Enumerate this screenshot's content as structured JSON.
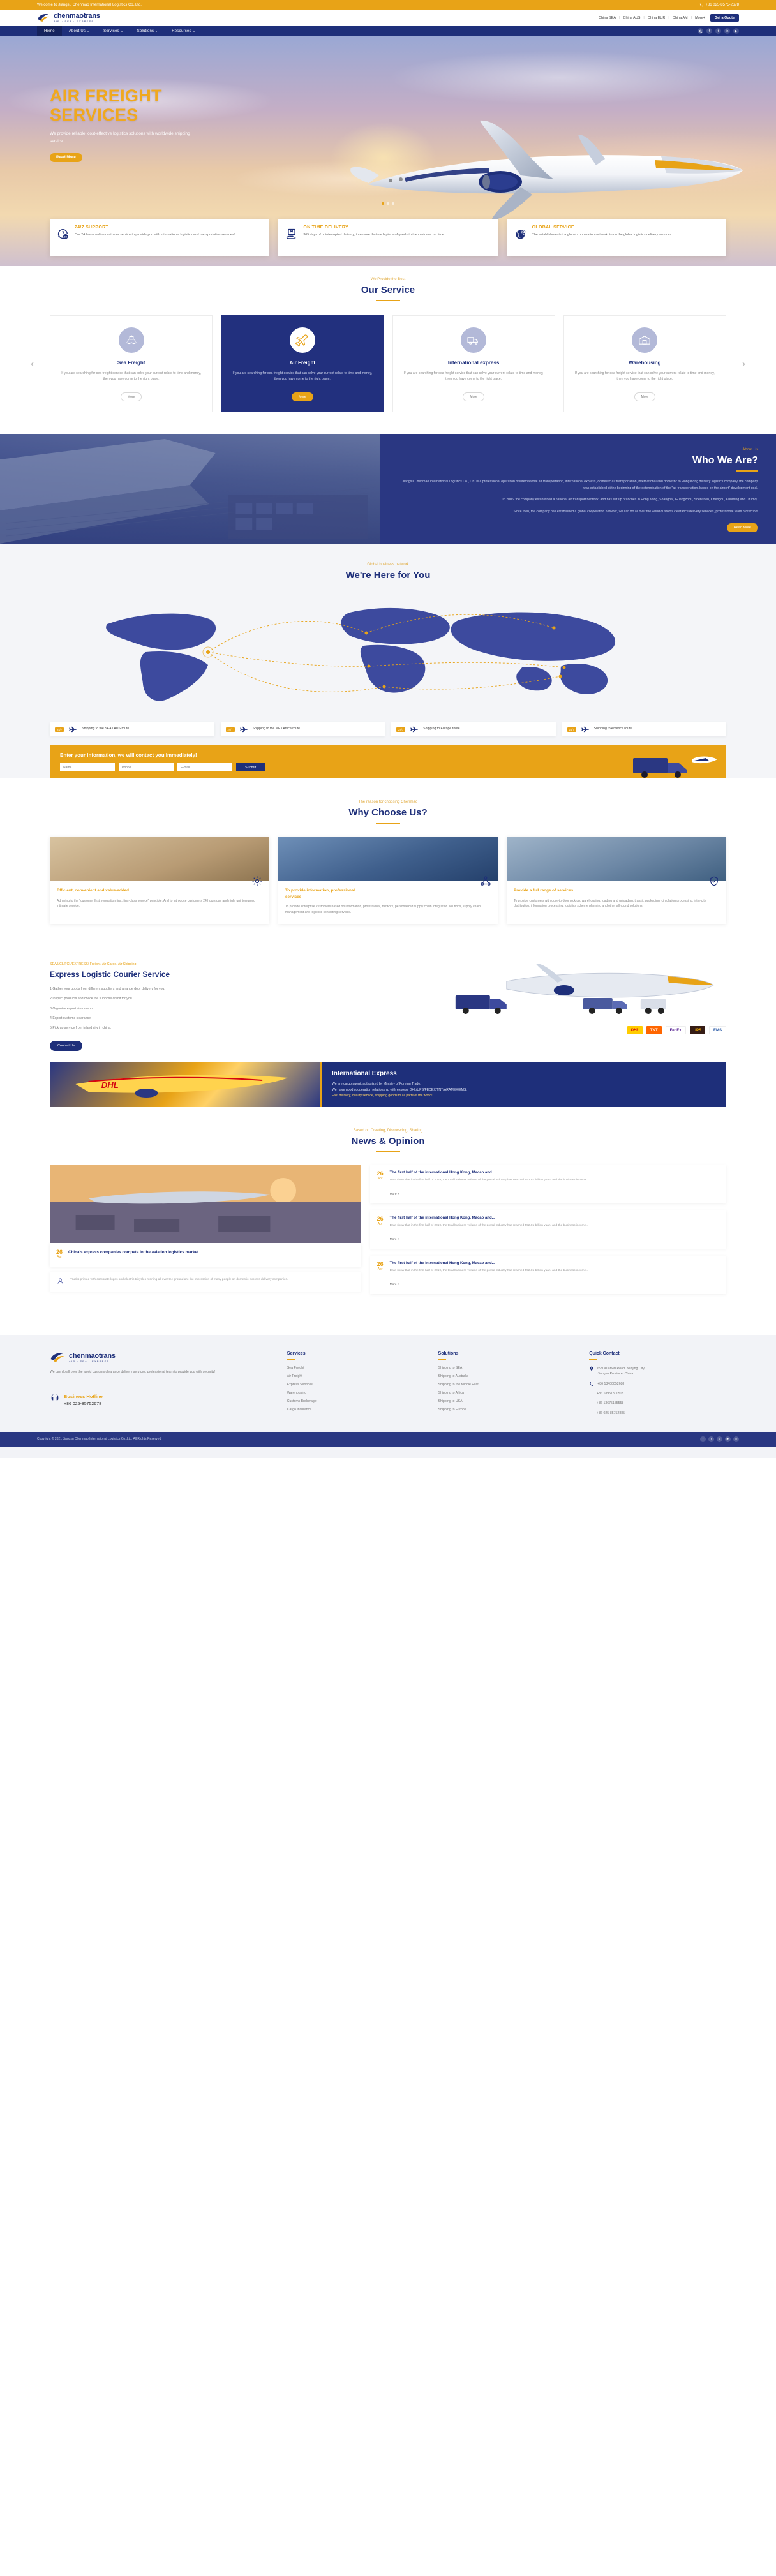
{
  "topbar": {
    "welcome": "Welcome to Jiangsu Chenmao International Logistics  Co.,Ltd.",
    "phone": "+86 025-8575-2678",
    "phone_icon": "phone-icon"
  },
  "header": {
    "logo_name": "chenmaotrans",
    "logo_sub": "AIR · SEA · EXPRESS",
    "lang": [
      "China SEA",
      "China AUS",
      "China EUR",
      "China AM",
      "More+"
    ],
    "quote_button": "Get a Quote"
  },
  "nav": {
    "items": [
      {
        "label": "Home",
        "caret": false,
        "active": true
      },
      {
        "label": "About Us",
        "caret": true,
        "active": false
      },
      {
        "label": "Services",
        "caret": true,
        "active": false
      },
      {
        "label": "Solutions",
        "caret": true,
        "active": false
      },
      {
        "label": "Resources",
        "caret": true,
        "active": false
      }
    ],
    "icons": [
      "search-icon",
      "facebook-icon",
      "twitter-icon",
      "linkedin-icon",
      "youtube-icon"
    ]
  },
  "hero": {
    "title_line1": "AIR FREIGHT",
    "title_line2": "SERVICES",
    "subtitle": "We provide reliable, cost-effective logistics solutions with worldwide shipping service.",
    "button": "Read More"
  },
  "features": [
    {
      "icon": "support-24-7-icon",
      "title": "24/7 SUPPORT",
      "text": "Our 24 hours online customer service to provide you with international logistics and transportation services!"
    },
    {
      "icon": "delivery-box-icon",
      "title": "ON TIME DELIVERY",
      "text": "365 days of uninterrupted delivery, to ensure that each piece of goods to the customer on time."
    },
    {
      "icon": "globe-network-icon",
      "title": "GLOBAL SERVICE",
      "text": "The establishment of a global cooperation network, to do the global logistics delivery services."
    }
  ],
  "services_section": {
    "eyebrow": "We Provide the Best",
    "title": "Our Service",
    "prev_arrow": "‹",
    "next_arrow": "›",
    "cards": [
      {
        "icon": "ship-icon",
        "title": "Sea Freight",
        "text": "If you are searching for sea freight service that can solve your current relate to time and money, then you have come to the right place.",
        "button": "More",
        "highlight": false
      },
      {
        "icon": "airplane-icon",
        "title": "Air Freight",
        "text": "If you are searching for sea freight service that can solve your current relate to time and money, then you have come to the right place.",
        "button": "More",
        "highlight": true
      },
      {
        "icon": "express-truck-icon",
        "title": "International express",
        "text": "If you are searching for sea freight service that can solve your current relate to time and money, then you have come to the right place.",
        "button": "More",
        "highlight": false
      },
      {
        "icon": "warehouse-icon",
        "title": "Warehousing",
        "text": "If you are searching for sea freight service that can solve your current relate to time and money, then you have come to the right place.",
        "button": "More",
        "highlight": false
      }
    ]
  },
  "who": {
    "eyebrow": "About Us",
    "title": "Who We Are?",
    "p1": "Jiangsu Chenmao International Logistics Co., Ltd. is a professional operation of international air transportation, international express, domestic air transportation, international and domestic to Hong Kong delivery logistics company, the company was established at the beginning of the determination of the \"air transportation, based on the airport\" development goal.",
    "p2": "In 2006, the company established a national air transport network, and has set up branches in Hong Kong, Shanghai, Guangzhou, Shenzhen, Chengdu, Kunming and Urumqi.",
    "p3": "Since then, the company has established a global cooperation network, we can do all over the world customs clearance delivery services, professional team protection!",
    "button": "Read More"
  },
  "map_section": {
    "eyebrow": "Global business network",
    "title": "We're Here for You",
    "routes": [
      {
        "badge": "24/7",
        "icon": "airplane-route-icon",
        "text": "Shipping to the SEA / AUS route"
      },
      {
        "badge": "24/7",
        "icon": "airplane-route-icon",
        "text": "Shipping to the ME / Africa route"
      },
      {
        "badge": "24/7",
        "icon": "airplane-route-icon",
        "text": "Shipping to Europe route"
      },
      {
        "badge": "24/7",
        "icon": "airplane-route-icon",
        "text": "Shipping to America route"
      }
    ]
  },
  "cta": {
    "title": "Enter your information, we will contact you immediately!",
    "name_placeholder": "Name",
    "phone_placeholder": "Phone",
    "email_placeholder": "E-mail",
    "submit": "Submit"
  },
  "why_section": {
    "eyebrow": "The reason for choosing Chenmao",
    "title": "Why Choose Us?",
    "cards": [
      {
        "image": "warehouse-shelves-photo",
        "mark": "gear-icon",
        "title": "Efficient, convenient and value-added",
        "text": "Adhering to the \"customer first, reputation first, first-class service\" principle, And to introduce customers 24 hours day and night uninterrupted intimate service."
      },
      {
        "image": "port-container-crane-photo",
        "mark": "network-icon",
        "title": "To provide information, professional services",
        "text": "To provide enterprise customers based on information, professional, network, personalized supply chain integration solutions, supply chain management and logistics consulting services."
      },
      {
        "image": "forklift-workers-photo",
        "mark": "shield-icon",
        "title": "Provide a full range of services",
        "text": "To provide customers with door-to-door pick up, warehousing, loading and unloading, transit, packaging, circulation processing, inter-city distribution, information processing, logistics scheme planning and other all-round solutions."
      }
    ]
  },
  "express": {
    "eyebrow": "SEA/LCL/FCL/EXPRESS/ Freight, Air Cargo, Air Shipping",
    "title": "Express Logistic Courier Service",
    "points": [
      "1 Gather your goods from different suppliers and arrange door delivery for you.",
      "2 Inspect products and check the suppose credit for you.",
      "3 Organize export documents.",
      "4 Export customs clearance.",
      "5 Pick up service from inland city in china."
    ],
    "button": "Contact Us",
    "visual": "cargo-plane-truck-photo",
    "carriers": [
      "DHL",
      "TNT",
      "FedEx",
      "UPS",
      "EMS"
    ]
  },
  "intl_express": {
    "image": "dhl-airplane-photo",
    "title": "International Express",
    "p1": "We are cargo agent, authorized by Ministry of Foreign Trade.",
    "p2": "We have good cooperation relationship with express DHL/UPS/FEDEX/TNT/ARAMEX/EMS.",
    "p3": "Fast delivery, quality service, shipping goods to all parts of the world!"
  },
  "news_section": {
    "eyebrow": "Based on Creating, Discovering, Sharing",
    "title": "News & Opinion",
    "featured": {
      "image": "airport-cargo-sunset-photo",
      "day": "26",
      "month": "Apr",
      "title": "China's express companies compete in the aviation logistics market.",
      "meta_icon": "user-icon",
      "text": "Trucks printed with corporate logos and electric tricycles running all over the ground are the impression of many people on domestic express delivery companies."
    },
    "items": [
      {
        "day": "26",
        "month": "Apr",
        "title": "The first half of the international Hong Kong, Macao and...",
        "text": "Data show that in the first half of 2019, the total business volume of the postal industry has reached 552.81 billion yuan, and the business income...",
        "more": "More +"
      },
      {
        "day": "26",
        "month": "Apr",
        "title": "The first half of the international Hong Kong, Macao and...",
        "text": "Data show that in the first half of 2019, the total business volume of the postal industry has reached 552.81 billion yuan, and the business income...",
        "more": "More +"
      },
      {
        "day": "26",
        "month": "Apr",
        "title": "The first half of the international Hong Kong, Macao and...",
        "text": "Data show that in the first half of 2019, the total business volume of the postal industry has reached 552.81 billion yuan, and the business income...",
        "more": "More +"
      }
    ]
  },
  "footer": {
    "logo_name": "chenmaotrans",
    "logo_sub": "AIR · SEA · EXPRESS",
    "about": "We can do all over the world customs clearance delivery services, professional team to provide you with security!",
    "hotline_icon": "headset-icon",
    "hotline_label": "Business Hotline",
    "hotline_number": "+86 025-85752678",
    "columns": [
      {
        "title": "Services",
        "items": [
          "Sea Freight",
          "Air Freight",
          "Express Services",
          "Warehousing",
          "Customs Brokerage",
          "Cargo Insurance"
        ]
      },
      {
        "title": "Solutions",
        "items": [
          "Shipping to SEA",
          "Shipping to Australia",
          "Shipping to the Middle East",
          "Shipping to Africa",
          "Shipping to USA",
          "Shipping to Europe"
        ]
      }
    ],
    "contact": {
      "title": "Quick Contact",
      "address_icon": "location-icon",
      "address_line1": "699 Xuanwu Road, Nanjing City,",
      "address_line2": "Jiangsu Province, China",
      "phone_icon": "phone-call-icon",
      "phones": [
        "+86 13400052688",
        "+86 18951800518",
        "+86 13675155558",
        "+86 025-85752885"
      ]
    },
    "copyright": "Copyright © 2021 Jiangsu Chenmao International Logistics  Co.,Ltd. All Rights Reserved",
    "socials": [
      "facebook-icon",
      "twitter-icon",
      "linkedin-icon",
      "youtube-icon",
      "instagram-icon"
    ]
  }
}
